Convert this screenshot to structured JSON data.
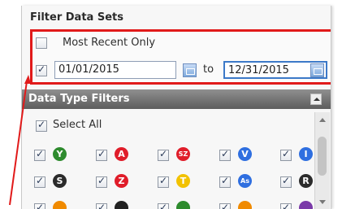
{
  "title": "Filter Data Sets",
  "most_recent": {
    "label": "Most Recent Only",
    "checked": false
  },
  "date_range": {
    "checked": true,
    "from": "01/01/2015",
    "to_label": "to",
    "to": "12/31/2015"
  },
  "type_filters": {
    "title": "Data Type Filters",
    "select_all_label": "Select All"
  },
  "lines_row1": [
    {
      "name": "line-y-icon",
      "glyph": "Y",
      "color": "#2e8b2e"
    },
    {
      "name": "line-a-icon",
      "glyph": "A",
      "color": "#e01d2a"
    },
    {
      "name": "line-sz-icon",
      "glyph": "SZ",
      "color": "#e01d2a"
    },
    {
      "name": "line-v-icon",
      "glyph": "V",
      "color": "#2f6fe0"
    },
    {
      "name": "line-i-icon",
      "glyph": "I",
      "color": "#2f6fe0"
    }
  ],
  "lines_row2": [
    {
      "name": "line-s-icon",
      "glyph": "S",
      "color": "#2b2b2b"
    },
    {
      "name": "line-z-icon",
      "glyph": "Z",
      "color": "#e01d2a"
    },
    {
      "name": "line-t-icon",
      "glyph": "T",
      "color": "#f2c200"
    },
    {
      "name": "line-as-icon",
      "glyph": "As",
      "color": "#2f6fe0"
    },
    {
      "name": "line-r-icon",
      "glyph": "R",
      "color": "#2b2b2b"
    }
  ],
  "lines_row3_partial": [
    {
      "name": "line-partial-icon-1",
      "glyph": "",
      "color": "#f08a00"
    },
    {
      "name": "line-partial-icon-2",
      "glyph": "",
      "color": "#222222"
    },
    {
      "name": "line-partial-icon-3",
      "glyph": "",
      "color": "#2e8b2e"
    },
    {
      "name": "line-partial-icon-4",
      "glyph": "",
      "color": "#f08a00"
    },
    {
      "name": "line-partial-icon-5",
      "glyph": "",
      "color": "#7a3aa8"
    }
  ],
  "colors": {
    "highlight_border": "#e11a1a",
    "header_bg": "#6e6e6e"
  }
}
